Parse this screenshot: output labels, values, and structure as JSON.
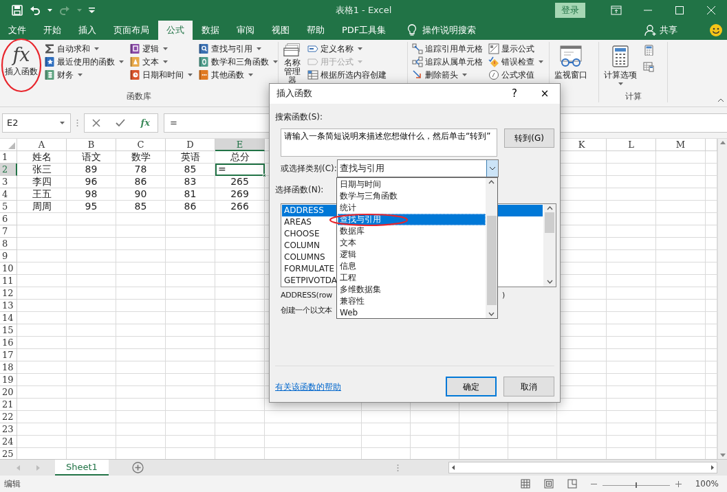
{
  "window": {
    "title": "表格1 - Excel",
    "sign_in": "登录"
  },
  "quick_access": [
    {
      "kind": "save",
      "disabled": false
    },
    {
      "kind": "undo",
      "disabled": false
    },
    {
      "kind": "redo",
      "disabled": true
    },
    {
      "kind": "customize",
      "disabled": false
    }
  ],
  "ribbon_tabs": [
    {
      "label": "文件",
      "selected": false
    },
    {
      "label": "开始",
      "selected": false
    },
    {
      "label": "插入",
      "selected": false
    },
    {
      "label": "页面布局",
      "selected": false
    },
    {
      "label": "公式",
      "selected": true
    },
    {
      "label": "数据",
      "selected": false
    },
    {
      "label": "审阅",
      "selected": false
    },
    {
      "label": "视图",
      "selected": false
    },
    {
      "label": "帮助",
      "selected": false
    },
    {
      "label": "PDF工具集",
      "selected": false
    }
  ],
  "tell_me": "操作说明搜索",
  "share": "共享",
  "ribbon": {
    "groups": [
      {
        "label": "函数库",
        "big": [
          {
            "kind": "insert_function",
            "icon_text": "fx",
            "label": "插入函数"
          }
        ],
        "columns": [
          [
            {
              "kind": "sum",
              "label": "自动求和",
              "dropdown": true,
              "disabled": false
            },
            {
              "kind": "recent",
              "label": "最近使用的函数",
              "dropdown": true,
              "disabled": false
            },
            {
              "kind": "finance",
              "label": "财务",
              "dropdown": true,
              "disabled": false
            }
          ],
          [
            {
              "kind": "logic",
              "label": "逻辑",
              "dropdown": true,
              "disabled": false
            },
            {
              "kind": "text",
              "label": "文本",
              "dropdown": true,
              "disabled": false
            },
            {
              "kind": "datetime",
              "label": "日期和时间",
              "dropdown": true,
              "disabled": false
            }
          ],
          [
            {
              "kind": "lookup",
              "label": "查找与引用",
              "dropdown": true,
              "disabled": false
            },
            {
              "kind": "math",
              "label": "数学和三角函数",
              "dropdown": true,
              "disabled": false
            },
            {
              "kind": "more",
              "label": "其他函数",
              "dropdown": true,
              "disabled": false
            }
          ]
        ]
      },
      {
        "big": [
          {
            "kind": "name_manager",
            "label": "名称管理器"
          }
        ],
        "columns": [
          [
            {
              "kind": "define_name",
              "label": "定义名称",
              "dropdown": true,
              "disabled": false
            },
            {
              "kind": "use_in_formula",
              "label": "用于公式",
              "dropdown": true,
              "disabled": true
            },
            {
              "kind": "create_from_selection",
              "label": "根据所选内容创建",
              "dropdown": false,
              "disabled": false
            }
          ]
        ]
      },
      {
        "columns": [
          [
            {
              "kind": "trace_precedents",
              "label": "追踪引用单元格",
              "dropdown": false,
              "disabled": false
            },
            {
              "kind": "trace_dependents",
              "label": "追踪从属单元格",
              "dropdown": false,
              "disabled": false
            },
            {
              "kind": "remove_arrows",
              "label": "删除箭头",
              "dropdown": true,
              "disabled": false
            }
          ],
          [
            {
              "kind": "show_formulas",
              "label": "显示公式",
              "dropdown": false,
              "disabled": false
            },
            {
              "kind": "error_checking",
              "label": "错误检查",
              "dropdown": true,
              "disabled": false
            },
            {
              "kind": "evaluate",
              "label": "公式求值",
              "dropdown": false,
              "disabled": false
            }
          ]
        ]
      },
      {
        "big": [
          {
            "kind": "watch_window",
            "label": "监视窗口"
          }
        ]
      },
      {
        "label": "计算",
        "big": [
          {
            "kind": "calc_options",
            "label": "计算选项",
            "dropdown": true
          }
        ],
        "columns": [
          [
            {
              "kind": "calc_now",
              "dropdown": false
            },
            {
              "kind": "calc_sheet",
              "dropdown": false
            }
          ]
        ]
      }
    ]
  },
  "formula_bar": {
    "name_box": "E2",
    "fx": "fx",
    "formula": "="
  },
  "sheet": {
    "columns": [
      {
        "label": "A",
        "selected": false
      },
      {
        "label": "B",
        "selected": false
      },
      {
        "label": "C",
        "selected": false
      },
      {
        "label": "D",
        "selected": false
      },
      {
        "label": "E",
        "selected": true
      },
      {
        "label": "K",
        "selected": false
      },
      {
        "label": "L",
        "selected": false
      },
      {
        "label": "M",
        "selected": false
      }
    ],
    "rows": [
      {
        "header": "1",
        "selected": false,
        "cells": [
          "姓名",
          "语文",
          "数学",
          "英语",
          "总分"
        ]
      },
      {
        "header": "2",
        "selected": true,
        "cells": [
          "张三",
          "89",
          "78",
          "85",
          "="
        ]
      },
      {
        "header": "3",
        "selected": false,
        "cells": [
          "李四",
          "96",
          "86",
          "83",
          "265"
        ]
      },
      {
        "header": "4",
        "selected": false,
        "cells": [
          "王五",
          "98",
          "90",
          "81",
          "269"
        ]
      },
      {
        "header": "5",
        "selected": false,
        "cells": [
          "周周",
          "95",
          "85",
          "86",
          "266"
        ]
      },
      {
        "header": "6",
        "selected": false
      },
      {
        "header": "7",
        "selected": false
      },
      {
        "header": "8",
        "selected": false
      },
      {
        "header": "9",
        "selected": false
      },
      {
        "header": "10",
        "selected": false
      },
      {
        "header": "11",
        "selected": false
      },
      {
        "header": "12",
        "selected": false
      },
      {
        "header": "13",
        "selected": false
      },
      {
        "header": "14",
        "selected": false
      },
      {
        "header": "15",
        "selected": false
      },
      {
        "header": "16",
        "selected": false
      },
      {
        "header": "17",
        "selected": false
      },
      {
        "header": "18",
        "selected": false
      },
      {
        "header": "19",
        "selected": false
      },
      {
        "header": "20",
        "selected": false
      },
      {
        "header": "21",
        "selected": false
      },
      {
        "header": "22",
        "selected": false
      },
      {
        "header": "23",
        "selected": false
      },
      {
        "header": "24",
        "selected": false
      },
      {
        "header": "25",
        "selected": false
      }
    ]
  },
  "sheet_tabs": [
    {
      "label": "Sheet1",
      "selected": true
    }
  ],
  "status": "编辑",
  "zoom_slider": {
    "level": 0.5
  },
  "zoom": "100%",
  "dialog": {
    "title": "插入函数",
    "help": "?",
    "close": "×",
    "search_label": "搜索函数(S):",
    "search_text": "请输入一条简短说明来描述您想做什么，然后单击“转到”",
    "go": "转到(G)",
    "category_label": "或选择类别(C):",
    "category": "查找与引用",
    "category_options": [
      {
        "label": "日期与时间",
        "selected": false
      },
      {
        "label": "数学与三角函数",
        "selected": false
      },
      {
        "label": "统计",
        "selected": false
      },
      {
        "label": "查找与引用",
        "selected": true
      },
      {
        "label": "数据库",
        "selected": false
      },
      {
        "label": "文本",
        "selected": false
      },
      {
        "label": "逻辑",
        "selected": false
      },
      {
        "label": "信息",
        "selected": false
      },
      {
        "label": "工程",
        "selected": false
      },
      {
        "label": "多维数据集",
        "selected": false
      },
      {
        "label": "兼容性",
        "selected": false
      },
      {
        "label": "Web",
        "selected": false
      }
    ],
    "function_label": "选择函数(N):",
    "functions": [
      {
        "label": "ADDRESS",
        "selected": true
      },
      {
        "label": "AREAS",
        "selected": false
      },
      {
        "label": "CHOOSE",
        "selected": false
      },
      {
        "label": "COLUMN",
        "selected": false
      },
      {
        "label": "COLUMNS",
        "selected": false
      },
      {
        "label": "FORMULATE",
        "selected": false
      },
      {
        "label": "GETPIVOTDA",
        "selected": false
      }
    ],
    "syntax": "ADDRESS(row",
    "syntax_end": ")",
    "description": "创建一个以文本",
    "help_link": "有关该函数的帮助",
    "ok": "确定",
    "cancel": "取消"
  }
}
